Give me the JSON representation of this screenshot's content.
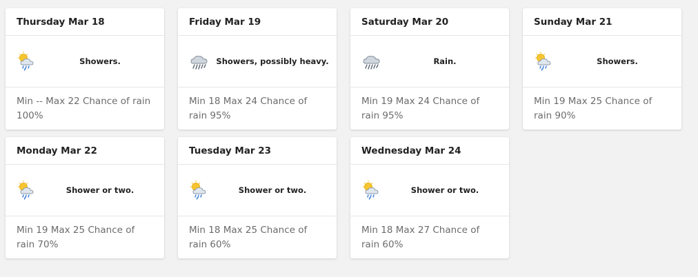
{
  "days": [
    {
      "date": "Thursday Mar 18",
      "icon": "showers-icon",
      "forecast": "Showers.",
      "details": "Min -- Max 22 Chance of rain 100%"
    },
    {
      "date": "Friday Mar 19",
      "icon": "heavy-showers-icon",
      "forecast": "Showers, possibly heavy.",
      "details": "Min 18 Max 24 Chance of rain 95%"
    },
    {
      "date": "Saturday Mar 20",
      "icon": "rain-icon",
      "forecast": "Rain.",
      "details": "Min 19 Max 24 Chance of rain 95%"
    },
    {
      "date": "Sunday Mar 21",
      "icon": "showers-icon",
      "forecast": "Showers.",
      "details": "Min 19 Max 25 Chance of rain 90%"
    },
    {
      "date": "Monday Mar 22",
      "icon": "showers-icon",
      "forecast": "Shower or two.",
      "details": "Min 19 Max 25 Chance of rain 70%"
    },
    {
      "date": "Tuesday Mar 23",
      "icon": "showers-icon",
      "forecast": "Shower or two.",
      "details": "Min 18 Max 25 Chance of rain 60%"
    },
    {
      "date": "Wednesday Mar 24",
      "icon": "showers-icon",
      "forecast": "Shower or two.",
      "details": "Min 18 Max 27 Chance of rain 60%"
    }
  ]
}
